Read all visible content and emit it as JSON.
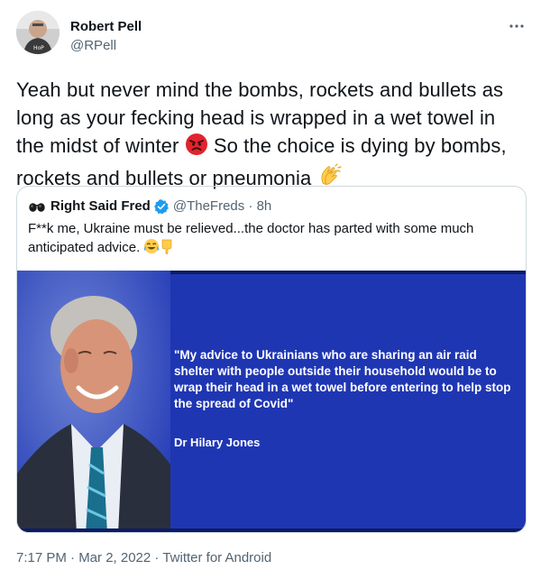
{
  "author": {
    "name": "Robert Pell",
    "handle": "@RPell"
  },
  "tweet": {
    "text_part1": "Yeah but never mind the bombs, rockets and bullets as long as your fecking head is wrapped in a wet towel in the midst of winter ",
    "emoji1": "angry-face",
    "text_part2": " So the choice is dying by bombs, rockets and bullets or pneumonia ",
    "emoji2": "clapping-hands"
  },
  "quote": {
    "name": "Right Said Fred",
    "handle": "@TheFreds · 8h",
    "verified": true,
    "text": "F**k me, Ukraine must be relieved...the doctor has parted with some much anticipated advice. ",
    "emojis": [
      "tears-of-joy",
      "backhand-index-pointing-down"
    ],
    "media": {
      "quote_text": "\"My advice to Ukrainians who are sharing an air raid shelter with people outside their household would be to wrap their head in a wet towel before entering to help stop the spread of Covid\"",
      "attribution": "Dr Hilary Jones",
      "background_color": "#1f36b3"
    }
  },
  "meta": {
    "timestamp": "7:17 PM · Mar 2, 2022 · ",
    "source": "Twitter for Android"
  },
  "colors": {
    "text": "#0f1419",
    "secondary": "#536471",
    "verified": "#1d9bf0",
    "border": "#cfd9de"
  }
}
